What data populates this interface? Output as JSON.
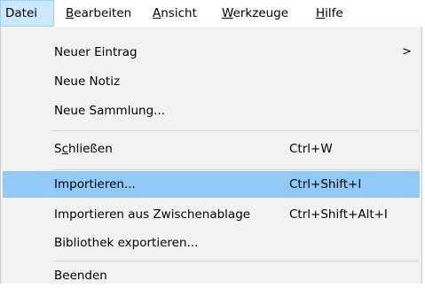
{
  "menubar": {
    "items": [
      {
        "label": "Datei",
        "open": true
      },
      {
        "label_pre": "",
        "accel": "B",
        "label_post": "earbeiten"
      },
      {
        "label_pre": "",
        "accel": "A",
        "label_post": "nsicht"
      },
      {
        "label_pre": "",
        "accel": "W",
        "label_post": "erkzeuge"
      },
      {
        "label_pre": "",
        "accel": "H",
        "label_post": "ilfe"
      }
    ]
  },
  "menu": {
    "new_entry": {
      "label": "Neuer Eintrag",
      "arrow": ">"
    },
    "new_note": {
      "label": "Neue Notiz"
    },
    "new_collection": {
      "label": "Neue Sammlung..."
    },
    "close": {
      "label_pre": "S",
      "accel": "c",
      "label_post": "hließen",
      "shortcut": "Ctrl+W"
    },
    "import": {
      "label": "Importieren...",
      "shortcut": "Ctrl+Shift+I"
    },
    "import_clipboard": {
      "label": "Importieren aus Zwischenablage",
      "shortcut": "Ctrl+Shift+Alt+I"
    },
    "export_library": {
      "label": "Bibliothek exportieren..."
    },
    "quit": {
      "label": "Beenden"
    }
  }
}
